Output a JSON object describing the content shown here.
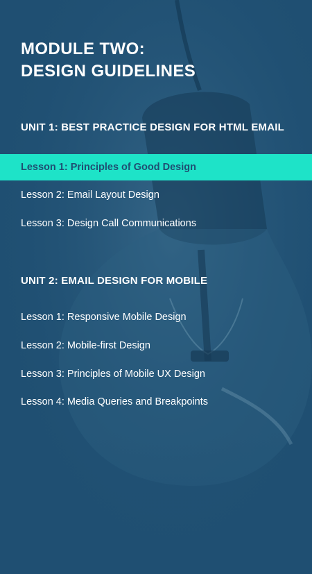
{
  "module": {
    "title_line1": "MODULE TWO:",
    "title_line2": "DESIGN GUIDELINES"
  },
  "units": [
    {
      "heading": "UNIT 1: BEST PRACTICE DESIGN FOR HTML EMAIL",
      "lessons": [
        {
          "label": "Lesson 1: Principles of Good Design",
          "active": true
        },
        {
          "label": "Lesson 2: Email Layout Design",
          "active": false
        },
        {
          "label": "Lesson 3: Design Call Communications",
          "active": false
        }
      ]
    },
    {
      "heading": "UNIT 2: EMAIL DESIGN FOR MOBILE",
      "lessons": [
        {
          "label": "Lesson 1: Responsive Mobile Design",
          "active": false
        },
        {
          "label": "Lesson 2: Mobile-first Design",
          "active": false
        },
        {
          "label": "Lesson 3: Principles of Mobile UX Design",
          "active": false
        },
        {
          "label": "Lesson 4: Media Queries and Breakpoints",
          "active": false
        }
      ]
    }
  ],
  "colors": {
    "background": "#1f4f72",
    "active_highlight": "#1ee3c8",
    "active_text": "#1f4f72",
    "text": "#ffffff"
  }
}
